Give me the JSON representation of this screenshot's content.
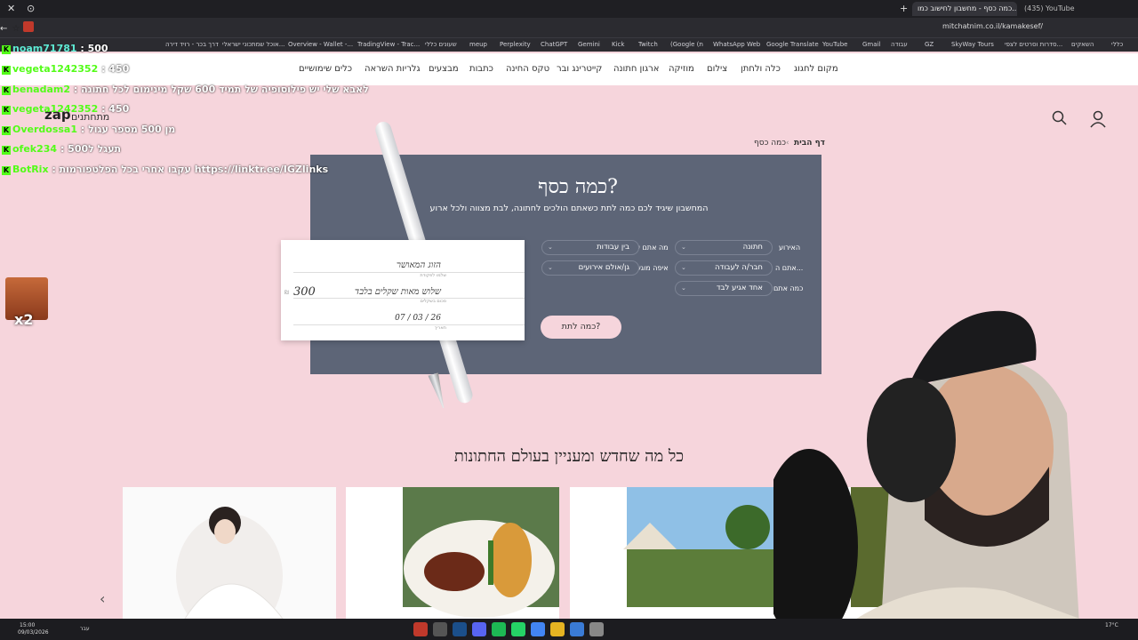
{
  "browser": {
    "tabs": [
      {
        "label": "כמה כסף - מחשבון לחישוב כמו..."
      },
      {
        "label": "(435) YouTube"
      }
    ],
    "url": "mitchatnim.co.il/kamakesef/",
    "bookmarks": [
      "כללי",
      "השאקים",
      "סדרות וסרטים לצפי...",
      "SkyWay Tours",
      "GZ",
      "עבודה",
      "Gmail",
      "YouTube",
      "Google Translate",
      "WhatsApp Web",
      "(Google (ת",
      "Twitch",
      "Kick",
      "Gemini",
      "ChatGPT",
      "Perplexity",
      "meup",
      "שעונים כללי",
      "TradingView - Trac...",
      "Overview - Wallet -...",
      "אוכל שמתכוני ישראלי...",
      "דרך בכר - רויד דירה"
    ]
  },
  "site_nav": {
    "items": [
      "מקום לחגוג",
      "כלה ולחתן",
      "צילום",
      "מוזיקה",
      "ארגון חתונה",
      "קייטרינג ובר",
      "טקס החינה",
      "כתבות",
      "מבצעים",
      "גלריות השראה",
      "כלים שימושיים"
    ]
  },
  "logo": {
    "brand": "zap",
    "sub": "מתחתנים"
  },
  "breadcrumb": {
    "home": "דף הבית",
    "current": "כמה כסף"
  },
  "calculator": {
    "title": "כמה כסף?",
    "subtitle": "המחשבון שיגיד לכם כמה לתת כשאתם הולכים לחתונה, לבת מצווה ולכל ארוע",
    "fields": [
      {
        "label": "האירוע",
        "value": "חתונה"
      },
      {
        "label": "אתם ה...",
        "value": "חבר/ה לעבודה"
      },
      {
        "label": "כמה אתם",
        "value": "אחד אגיע לבד"
      },
      {
        "label": "מה אתם עושים",
        "value": "בין עבודות"
      },
      {
        "label": "איפה מוגשים",
        "value": "גן/אולם אירועים"
      }
    ],
    "button": "כמה לתת?"
  },
  "check": {
    "payee": "הזוג המאושר",
    "payee_caption": "שלמו לפקודת",
    "amount_words": "שלוש מאות שקלים בלבד",
    "amount_caption": "סכום בשקלים",
    "amount": "300",
    "currency": "₪",
    "date": "07 / 03 / 26",
    "date_caption": "תאריך"
  },
  "section": {
    "title": "כל מה שחדש ומעניין בעולם החתונות"
  },
  "chat": [
    {
      "user": "noam71781",
      "msg": ": 500"
    },
    {
      "user": "vegeta1242352",
      "msg": ": 450"
    },
    {
      "user": "benadam2",
      "msg": ": לאבא שלי יש פילוסופיה של תמיד 600 שקל מינימום לכל חתונה"
    },
    {
      "user": "vegeta1242352",
      "msg": ": 450"
    },
    {
      "user": "Overdossa1",
      "msg": ": מן 500 מספר עגול"
    },
    {
      "user": "ofek234",
      "msg": ": תעגל ל500"
    },
    {
      "user": "BotRix",
      "msg": ": עקבו אחרי בכל הפלטפורמות https://linktr.ee/IGZlinks"
    }
  ],
  "emote_multiplier": "x2",
  "taskbar": {
    "time": "15:00",
    "date": "09/03/2026",
    "temp": "17°C",
    "lang": "עבר"
  },
  "colors": {
    "page_bg": "#f6d5dc",
    "panel_bg": "#5d6577",
    "chat_user": "#53fc18",
    "kick_green": "#53fc18"
  }
}
